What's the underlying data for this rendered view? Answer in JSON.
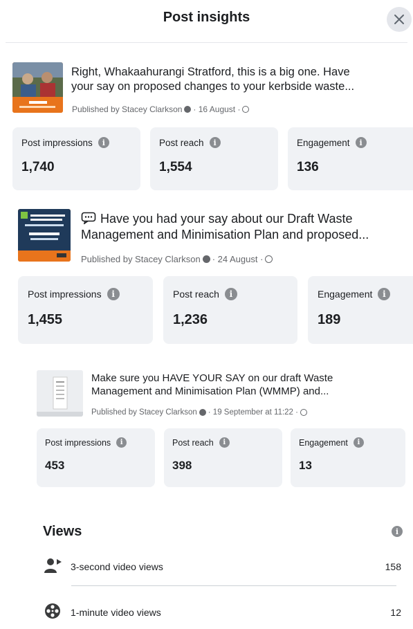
{
  "header": {
    "title": "Post insights"
  },
  "posts": [
    {
      "line1": "Right, Whakaahurangi Stratford, this is a big one. Have",
      "line2": "your say on proposed changes to your kerbside waste...",
      "author": "Published by Stacey Clarkson",
      "date": "· 16 August ·",
      "metrics": [
        {
          "label": "Post impressions",
          "value": "1,740"
        },
        {
          "label": "Post reach",
          "value": "1,554"
        },
        {
          "label": "Engagement",
          "value": "136"
        }
      ]
    },
    {
      "line1": "Have you had your say about our Draft Waste",
      "line2": "Management and Minimisation Plan and proposed...",
      "author": "Published by Stacey Clarkson",
      "date": "· 24 August ·",
      "metrics": [
        {
          "label": "Post impressions",
          "value": "1,455"
        },
        {
          "label": "Post reach",
          "value": "1,236"
        },
        {
          "label": "Engagement",
          "value": "189"
        }
      ]
    },
    {
      "line1": "Make sure you HAVE YOUR SAY on our draft Waste",
      "line2": "Management and Minimisation Plan (WMMP) and...",
      "author": "Published by Stacey Clarkson",
      "date": "· 19 September at 11:22 ·",
      "metrics": [
        {
          "label": "Post impressions",
          "value": "453"
        },
        {
          "label": "Post reach",
          "value": "398"
        },
        {
          "label": "Engagement",
          "value": "13"
        }
      ]
    }
  ],
  "views": {
    "title": "Views",
    "rows": [
      {
        "label": "3-second video views",
        "value": "158",
        "icon": "person-video-icon"
      },
      {
        "label": "1-minute video views",
        "value": "12",
        "icon": "film-reel-icon"
      }
    ]
  },
  "colors": {
    "card_bg": "#f0f2f5",
    "secondary_text": "#65676b",
    "info_icon": "#8a8d91",
    "thumb_orange": "#e8741c"
  }
}
